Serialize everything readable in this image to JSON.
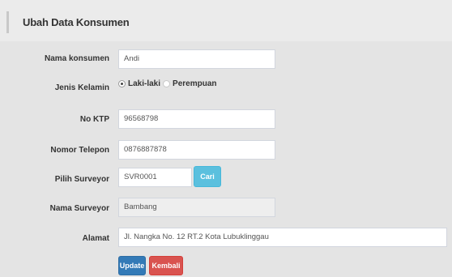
{
  "form": {
    "title": "Ubah Data Konsumen",
    "fields": {
      "nama_konsumen": {
        "label": "Nama konsumen",
        "value": "Andi"
      },
      "jenis_kelamin": {
        "label": "Jenis Kelamin",
        "options": [
          "Laki-laki",
          "Perempuan"
        ],
        "selected": "Laki-laki"
      },
      "no_ktp": {
        "label": "No KTP",
        "value": "96568798"
      },
      "nomor_telepon": {
        "label": "Nomor Telepon",
        "value": "0876887878"
      },
      "pilih_surveyor": {
        "label": "Pilih Surveyor",
        "value": "SVR0001",
        "button": "Cari"
      },
      "nama_surveyor": {
        "label": "Nama Surveyor",
        "value": "Bambang"
      },
      "alamat": {
        "label": "Alamat",
        "value": "Jl. Nangka No. 12 RT.2 Kota Lubuklinggau"
      }
    },
    "buttons": {
      "update": "Update",
      "kembali": "Kembali"
    }
  },
  "colors": {
    "panel_bg": "#e4e4e4",
    "header_bg": "#ebebeb",
    "info": "#5bc0de",
    "primary": "#337ab7",
    "danger": "#d9534f"
  }
}
